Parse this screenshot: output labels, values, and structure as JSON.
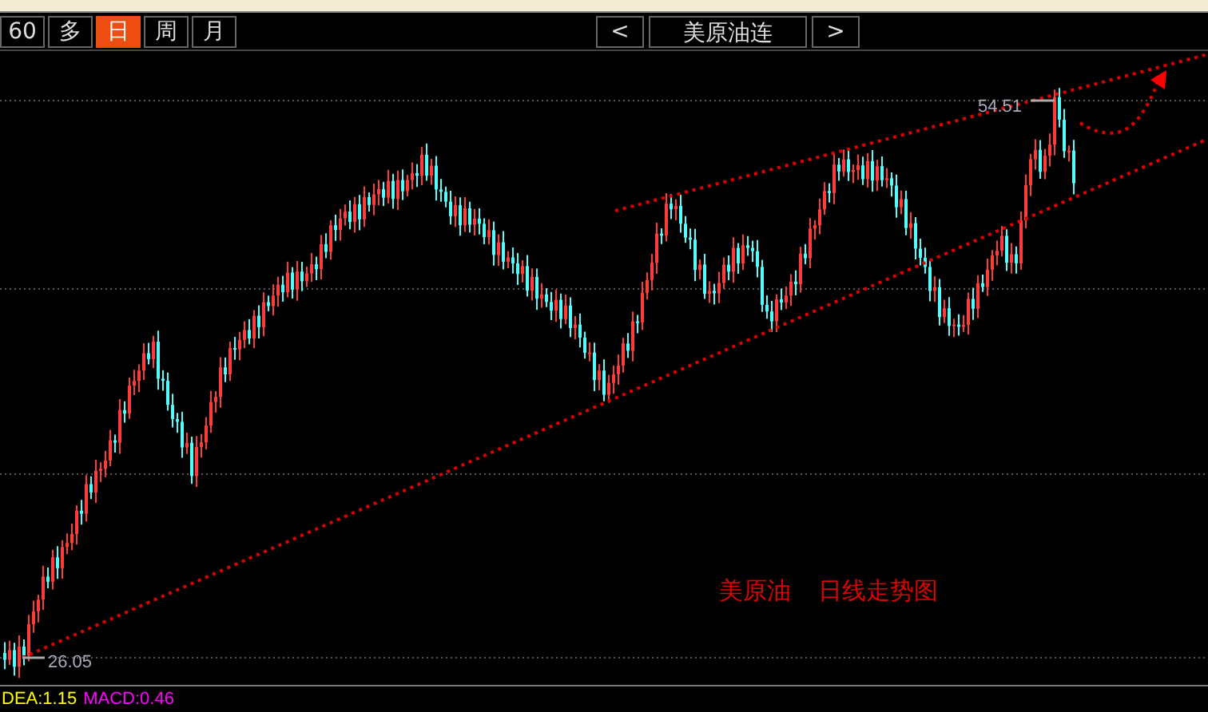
{
  "toolbar": {
    "periods": [
      {
        "label": "60",
        "selected": false
      },
      {
        "label": "多",
        "selected": false
      },
      {
        "label": "日",
        "selected": true
      },
      {
        "label": "周",
        "selected": false
      },
      {
        "label": "月",
        "selected": false
      }
    ],
    "prev": "<",
    "symbol": "美原油连",
    "next": ">"
  },
  "chart": {
    "high_label": "54.51",
    "low_label": "26.05",
    "caption": [
      "美原油",
      "日线走势图"
    ]
  },
  "indicators": [
    {
      "label": "DEA:1.15",
      "color": "#ffff00"
    },
    {
      "label": "MACD:0.46",
      "color": "#ff00ff"
    }
  ]
}
